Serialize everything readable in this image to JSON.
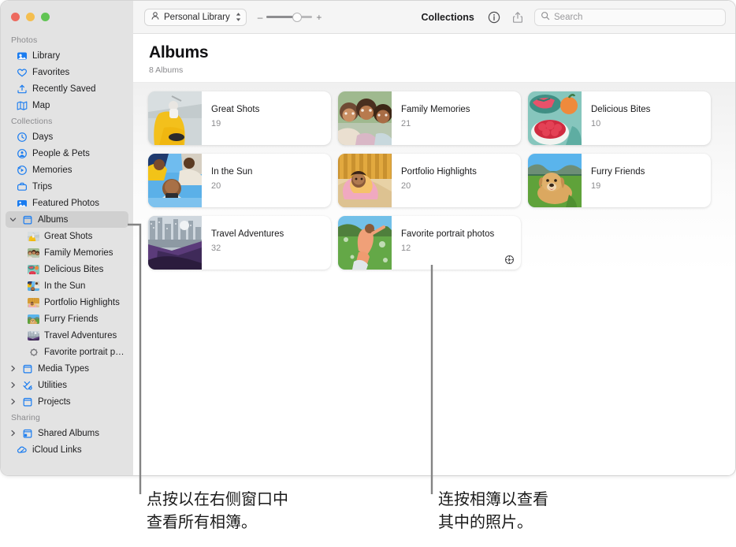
{
  "window": {
    "traffic_lights": [
      "close",
      "minimize",
      "zoom"
    ]
  },
  "toolbar": {
    "library_label": "Personal Library",
    "library_icon": "person-icon",
    "zoom_minus": "–",
    "zoom_plus": "+",
    "zoom_level": 58,
    "title": "Collections",
    "info_icon": "info-circle-icon",
    "share_icon": "share-icon",
    "search_placeholder": "Search",
    "search_value": "",
    "search_icon": "search-icon"
  },
  "sidebar": {
    "sections": [
      {
        "label": "Photos",
        "items": [
          {
            "label": "Library",
            "icon": "photos-library-icon",
            "selected": false,
            "indent": false,
            "disclosure": "none"
          },
          {
            "label": "Favorites",
            "icon": "heart-icon",
            "selected": false,
            "indent": false,
            "disclosure": "none"
          },
          {
            "label": "Recently Saved",
            "icon": "tray-arrow-up-icon",
            "selected": false,
            "indent": false,
            "disclosure": "none"
          },
          {
            "label": "Map",
            "icon": "map-icon",
            "selected": false,
            "indent": false,
            "disclosure": "none"
          }
        ]
      },
      {
        "label": "Collections",
        "items": [
          {
            "label": "Days",
            "icon": "clock-icon",
            "selected": false,
            "indent": false,
            "disclosure": "none"
          },
          {
            "label": "People & Pets",
            "icon": "person-circle-icon",
            "selected": false,
            "indent": false,
            "disclosure": "none"
          },
          {
            "label": "Memories",
            "icon": "memories-play-icon",
            "selected": false,
            "indent": false,
            "disclosure": "none"
          },
          {
            "label": "Trips",
            "icon": "suitcase-icon",
            "selected": false,
            "indent": false,
            "disclosure": "none"
          },
          {
            "label": "Featured Photos",
            "icon": "featured-photos-icon",
            "selected": false,
            "indent": false,
            "disclosure": "none"
          },
          {
            "label": "Albums",
            "icon": "albums-folder-icon",
            "selected": true,
            "indent": false,
            "disclosure": "expanded"
          },
          {
            "label": "Great Shots",
            "icon": "album-thumb",
            "selected": false,
            "indent": true,
            "disclosure": "none",
            "thumb": "great-shots"
          },
          {
            "label": "Family Memories",
            "icon": "album-thumb",
            "selected": false,
            "indent": true,
            "disclosure": "none",
            "thumb": "family-memories"
          },
          {
            "label": "Delicious Bites",
            "icon": "album-thumb",
            "selected": false,
            "indent": true,
            "disclosure": "none",
            "thumb": "delicious-bites"
          },
          {
            "label": "In the Sun",
            "icon": "album-thumb",
            "selected": false,
            "indent": true,
            "disclosure": "none",
            "thumb": "in-the-sun"
          },
          {
            "label": "Portfolio Highlights",
            "icon": "album-thumb",
            "selected": false,
            "indent": true,
            "disclosure": "none",
            "thumb": "portfolio-highlights"
          },
          {
            "label": "Furry Friends",
            "icon": "album-thumb",
            "selected": false,
            "indent": true,
            "disclosure": "none",
            "thumb": "furry-friends"
          },
          {
            "label": "Travel Adventures",
            "icon": "album-thumb",
            "selected": false,
            "indent": true,
            "disclosure": "none",
            "thumb": "travel-adventures"
          },
          {
            "label": "Favorite portrait photos",
            "icon": "smart-album-gear-icon",
            "selected": false,
            "indent": true,
            "disclosure": "none"
          },
          {
            "label": "Media Types",
            "icon": "albums-folder-icon",
            "selected": false,
            "indent": false,
            "disclosure": "collapsed"
          },
          {
            "label": "Utilities",
            "icon": "utilities-tools-icon",
            "selected": false,
            "indent": false,
            "disclosure": "collapsed"
          },
          {
            "label": "Projects",
            "icon": "albums-folder-icon",
            "selected": false,
            "indent": false,
            "disclosure": "collapsed"
          }
        ]
      },
      {
        "label": "Sharing",
        "items": [
          {
            "label": "Shared Albums",
            "icon": "shared-albums-icon",
            "selected": false,
            "indent": false,
            "disclosure": "collapsed"
          },
          {
            "label": "iCloud Links",
            "icon": "icloud-link-icon",
            "selected": false,
            "indent": false,
            "disclosure": "none"
          }
        ]
      }
    ]
  },
  "content": {
    "title": "Albums",
    "subtitle": "8 Albums",
    "albums": [
      {
        "title": "Great Shots",
        "count": "19",
        "thumb": "great-shots",
        "smart": false
      },
      {
        "title": "Family Memories",
        "count": "21",
        "thumb": "family-memories",
        "smart": false
      },
      {
        "title": "Delicious Bites",
        "count": "10",
        "thumb": "delicious-bites",
        "smart": false
      },
      {
        "title": "In the Sun",
        "count": "20",
        "thumb": "in-the-sun",
        "smart": false
      },
      {
        "title": "Portfolio Highlights",
        "count": "20",
        "thumb": "portfolio-highlights",
        "smart": false
      },
      {
        "title": "Furry Friends",
        "count": "19",
        "thumb": "furry-friends",
        "smart": false
      },
      {
        "title": "Travel Adventures",
        "count": "32",
        "thumb": "travel-adventures",
        "smart": false
      },
      {
        "title": "Favorite portrait photos",
        "count": "12",
        "thumb": "favorite-portrait",
        "smart": true
      }
    ]
  },
  "callouts": [
    {
      "id": "callout-1",
      "text": "点按以在右侧窗口中\n查看所有相簿。"
    },
    {
      "id": "callout-2",
      "text": "连按相簿以查看\n其中的照片。"
    }
  ],
  "colors": {
    "accent": "#1a7cf0",
    "sidebar_bg": "#e3e3e3",
    "selected_bg": "#d0d0d0",
    "toolbar_bg": "#f5f5f5",
    "callout_line": "#848484"
  }
}
